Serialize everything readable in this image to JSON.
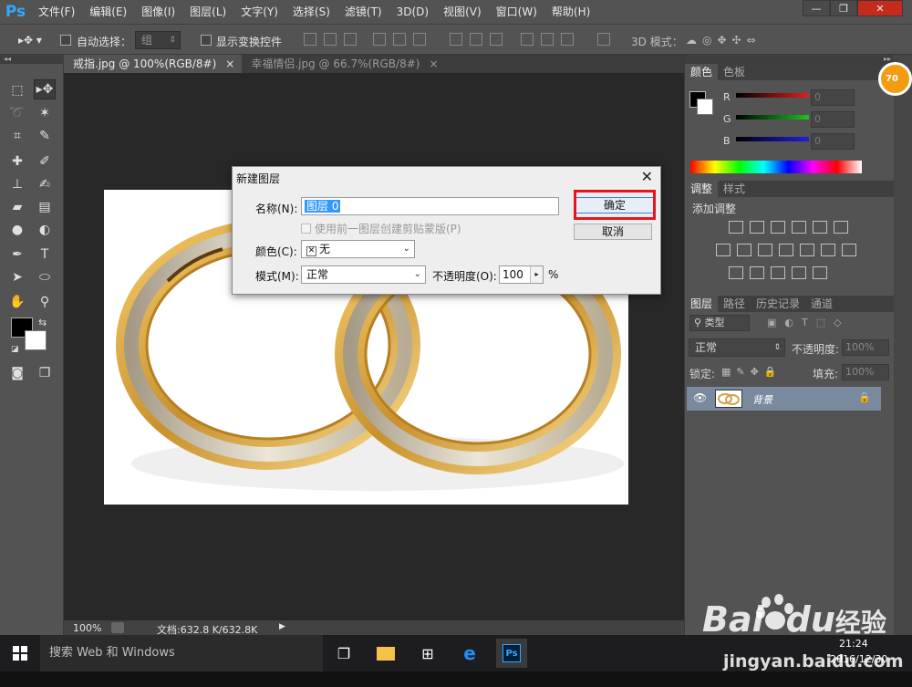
{
  "app": {
    "logo": "Ps"
  },
  "menu": [
    "文件(F)",
    "编辑(E)",
    "图像(I)",
    "图层(L)",
    "文字(Y)",
    "选择(S)",
    "滤镜(T)",
    "3D(D)",
    "视图(V)",
    "窗口(W)",
    "帮助(H)"
  ],
  "options": {
    "auto_select_label": "自动选择：",
    "auto_select_value": "组",
    "show_transform_label": "显示变换控件",
    "mode_3d_label": "3D 模式："
  },
  "tabs": [
    {
      "label": "戒指.jpg @ 100%(RGB/8#)",
      "active": true
    },
    {
      "label": "幸福情侣.jpg @ 66.7%(RGB/8#)",
      "active": false
    }
  ],
  "tab_close_glyph": "×",
  "status": {
    "zoom": "100%",
    "doc": "文档:632.8 K/632.8K"
  },
  "dialog": {
    "title": "新建图层",
    "name_label": "名称(N):",
    "name_value": "图层 0",
    "clip_label": "使用前一图层创建剪贴蒙版(P)",
    "color_label": "颜色(C):",
    "color_value": "无",
    "mode_label": "模式(M):",
    "mode_value": "正常",
    "opacity_label": "不透明度(O):",
    "opacity_value": "100",
    "opacity_unit": "%",
    "ok": "确定",
    "cancel": "取消"
  },
  "color_panel": {
    "tabs": [
      "颜色",
      "色板"
    ],
    "channels": [
      {
        "label": "R",
        "value": "0",
        "color": "#e02020"
      },
      {
        "label": "G",
        "value": "0",
        "color": "#20c020"
      },
      {
        "label": "B",
        "value": "0",
        "color": "#2020e0"
      }
    ]
  },
  "adjust_panel": {
    "tabs": [
      "调整",
      "样式"
    ],
    "hint": "添加调整"
  },
  "layers_panel": {
    "tabs": [
      "图层",
      "路径",
      "历史记录",
      "通道"
    ],
    "filter_label": "类型",
    "blend_mode": "正常",
    "opacity_label": "不透明度:",
    "opacity_value": "100%",
    "lock_label": "锁定:",
    "fill_label": "填充:",
    "fill_value": "100%",
    "layer_name": "背景"
  },
  "taskbar": {
    "search": "搜索 Web 和 Windows",
    "time": "21:24",
    "date": "2016/12/30"
  },
  "badge": "70",
  "watermark": {
    "brand": "Bai",
    "brand2": "du",
    "brand3": "经验",
    "site": "jingyan.baidu.com"
  }
}
